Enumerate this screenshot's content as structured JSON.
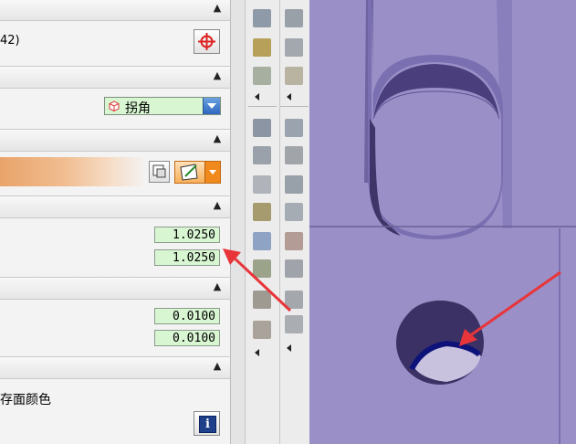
{
  "panel": {
    "point_label": "42)",
    "chamfer_type_value": "拐角",
    "values": [
      "1.0250",
      "1.0250",
      "0.0100",
      "0.0100"
    ],
    "face_color_label": "存面颜色"
  },
  "icons": {
    "point_button": "target-icon",
    "combo_icon": "cube-icon",
    "info_button": "info-icon",
    "info_glyph": "i"
  },
  "colors": {
    "input_bg": "#d9f6d3",
    "viewport_bg": "#9a8fc7",
    "arrow": "#e8353a",
    "orange_gradient": "#e9a36a"
  }
}
